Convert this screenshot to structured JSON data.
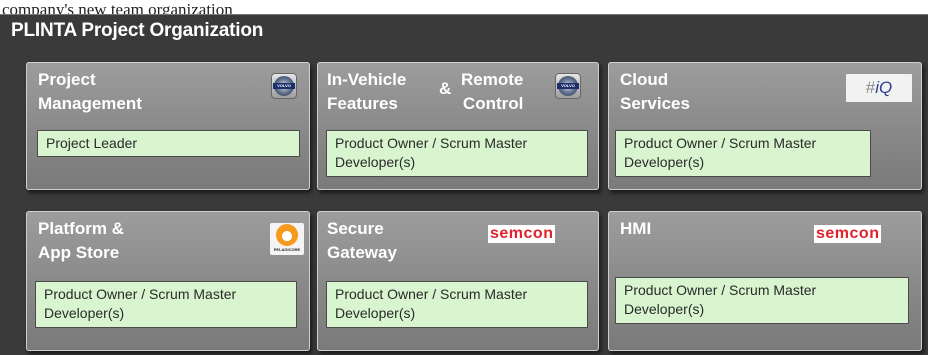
{
  "caption": "company's new team organization",
  "title": "PLINTA Project Organization",
  "cards": [
    {
      "title": "Project\nManagement",
      "logo": "volvo-logo",
      "roles": "Project Leader"
    },
    {
      "title_left": "In-Vehicle\nFeatures",
      "title_amp": "&",
      "title_right": "Remote\nControl",
      "logo": "volvo-logo",
      "roles": "Product Owner / Scrum Master\nDeveloper(s)"
    },
    {
      "title": "Cloud\nServices",
      "logo": "hiq-logo",
      "logo_text": "HiQ",
      "roles": "Product Owner / Scrum Master\nDeveloper(s)"
    },
    {
      "title": "Platform &\nApp Store",
      "logo": "pelagicore-logo",
      "logo_text": "PELAGICORE",
      "roles": "Product Owner / Scrum Master\nDeveloper(s)"
    },
    {
      "title": "Secure\nGateway",
      "logo": "semcon-logo",
      "logo_text": "semcon",
      "roles": "Product Owner / Scrum Master\nDeveloper(s)"
    },
    {
      "title": "HMI",
      "logo": "semcon-logo",
      "logo_text": "semcon",
      "roles": "Product Owner / Scrum Master\nDeveloper(s)"
    }
  ],
  "volvo_text": "VOLVO",
  "colors": {
    "background": "#3a3a3a",
    "card": "#8a8a8a",
    "role_box": "#d8f5cf",
    "semcon_red": "#e3222c"
  }
}
